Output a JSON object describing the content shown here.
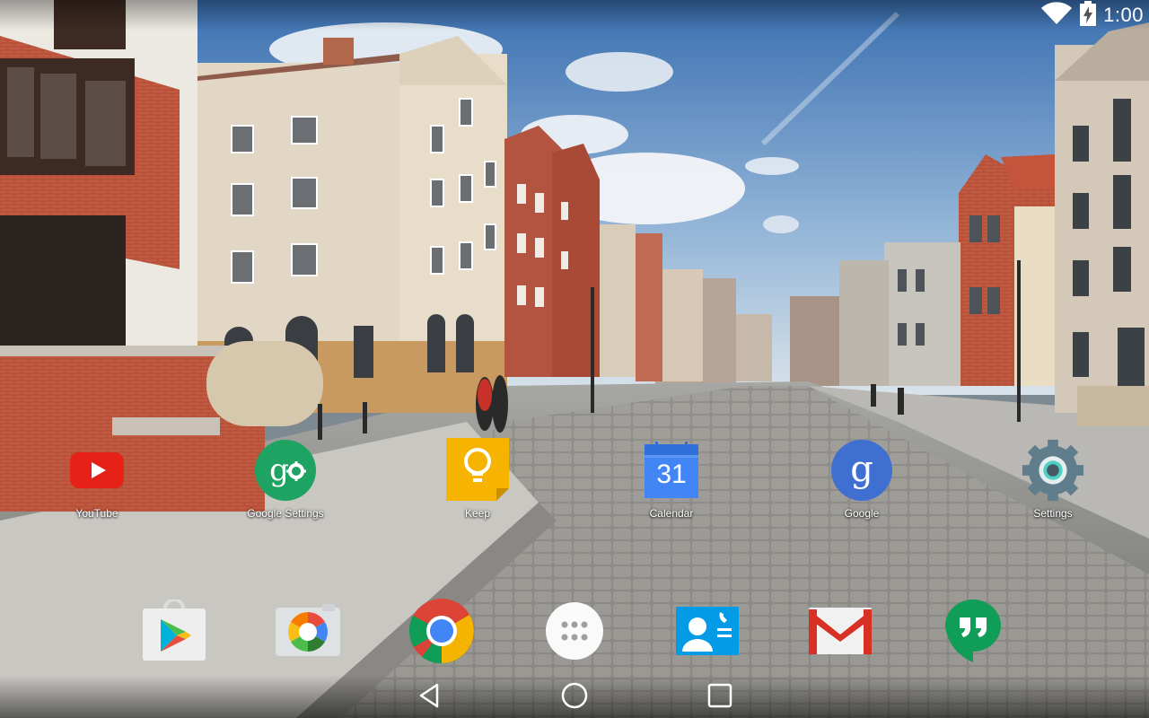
{
  "status_bar": {
    "time": "1:00",
    "icons": [
      "wifi-icon",
      "battery-charging-icon"
    ]
  },
  "home_screen": {
    "apps": [
      {
        "label": "YouTube",
        "icon": "youtube-icon"
      },
      {
        "label": "Google Settings",
        "icon": "google-settings-icon"
      },
      {
        "label": "Keep",
        "icon": "keep-icon"
      },
      {
        "label": "Calendar",
        "icon": "calendar-icon",
        "date": "31"
      },
      {
        "label": "Google",
        "icon": "google-search-icon"
      },
      {
        "label": "Settings",
        "icon": "settings-gear-icon"
      }
    ]
  },
  "dock": {
    "apps": [
      "play-store-icon",
      "camera-icon",
      "chrome-icon",
      "app-drawer-icon",
      "contacts-icon",
      "gmail-icon",
      "hangouts-icon"
    ]
  },
  "nav_bar": {
    "buttons": [
      "back-icon",
      "home-icon",
      "recents-icon"
    ]
  },
  "colors": {
    "youtube_red": "#e62117",
    "google_green": "#1ea362",
    "keep_yellow": "#f6b400",
    "calendar_blue": "#4285f4",
    "google_blue": "#3f6fd1",
    "settings_gray": "#607d8b",
    "gmail_red": "#d93025",
    "hangouts_green": "#0f9d58"
  }
}
